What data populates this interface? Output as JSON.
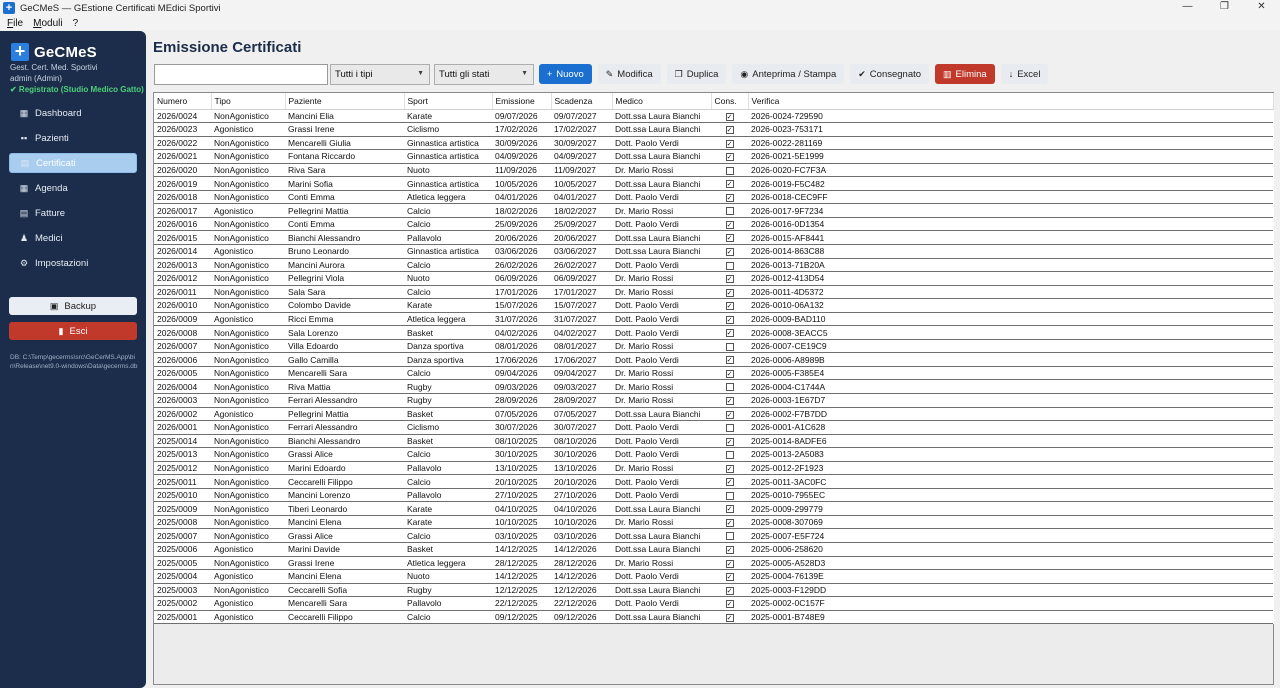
{
  "window": {
    "title": "GeCMeS — GEstione Certificati MEdici Sportivi",
    "minimize": "—",
    "maximize": "❐",
    "close": "✕"
  },
  "menu": [
    "File",
    "Moduli",
    "?"
  ],
  "sidebar": {
    "brand": "GeCMeS",
    "subtitle": "Gest. Cert. Med. Sportivi",
    "user": "admin (Admin)",
    "registered": "✔ Registrato (Studio Medico Gatto)",
    "items": [
      {
        "label": "Dashboard",
        "icon": "dashboard-icon",
        "glyph": "▦"
      },
      {
        "label": "Pazienti",
        "icon": "users-icon",
        "glyph": "👥"
      },
      {
        "label": "Certificati",
        "icon": "certificate-icon",
        "glyph": "▤"
      },
      {
        "label": "Agenda",
        "icon": "calendar-icon",
        "glyph": "▦"
      },
      {
        "label": "Fatture",
        "icon": "invoice-icon",
        "glyph": "▤"
      },
      {
        "label": "Medici",
        "icon": "doctor-icon",
        "glyph": "♟"
      },
      {
        "label": "Impostazioni",
        "icon": "gear-icon",
        "glyph": "⚙"
      }
    ],
    "backup_label": "Backup",
    "exit_label": "Esci",
    "db_path": "DB: C:\\Temp\\gecerms\\src\\GeCerMS.App\\bin\\Release\\net9.0-windows\\Data\\gecerms.db"
  },
  "main": {
    "heading": "Emissione Certificati",
    "search_value": "",
    "type_filter": "Tutti i tipi",
    "state_filter": "Tutti gli stati",
    "buttons": {
      "new": "Nuovo",
      "edit": "Modifica",
      "duplicate": "Duplica",
      "preview": "Anteprima / Stampa",
      "delivered": "Consegnato",
      "delete": "Elimina",
      "excel": "Excel"
    }
  },
  "table": {
    "columns": [
      "Numero",
      "Tipo",
      "Paziente",
      "Sport",
      "Emissione",
      "Scadenza",
      "Medico",
      "Cons.",
      "Verifica"
    ],
    "rows": [
      [
        "2026/0024",
        "NonAgonistico",
        "Mancini Elia",
        "Karate",
        "09/07/2026",
        "09/07/2027",
        "Dott.ssa Laura Bianchi",
        true,
        "2026-0024-729590"
      ],
      [
        "2026/0023",
        "Agonistico",
        "Grassi Irene",
        "Ciclismo",
        "17/02/2026",
        "17/02/2027",
        "Dott.ssa Laura Bianchi",
        true,
        "2026-0023-753171"
      ],
      [
        "2026/0022",
        "NonAgonistico",
        "Mencarelli Giulia",
        "Ginnastica artistica",
        "30/09/2026",
        "30/09/2027",
        "Dott. Paolo Verdi",
        true,
        "2026-0022-281169"
      ],
      [
        "2026/0021",
        "NonAgonistico",
        "Fontana Riccardo",
        "Ginnastica artistica",
        "04/09/2026",
        "04/09/2027",
        "Dott.ssa Laura Bianchi",
        true,
        "2026-0021-5E1999"
      ],
      [
        "2026/0020",
        "NonAgonistico",
        "Riva Sara",
        "Nuoto",
        "11/09/2026",
        "11/09/2027",
        "Dr. Mario Rossi",
        false,
        "2026-0020-FC7F3A"
      ],
      [
        "2026/0019",
        "NonAgonistico",
        "Marini Sofia",
        "Ginnastica artistica",
        "10/05/2026",
        "10/05/2027",
        "Dott.ssa Laura Bianchi",
        true,
        "2026-0019-F5C482"
      ],
      [
        "2026/0018",
        "NonAgonistico",
        "Conti Emma",
        "Atletica leggera",
        "04/01/2026",
        "04/01/2027",
        "Dott. Paolo Verdi",
        true,
        "2026-0018-CEC9FF"
      ],
      [
        "2026/0017",
        "Agonistico",
        "Pellegrini Mattia",
        "Calcio",
        "18/02/2026",
        "18/02/2027",
        "Dr. Mario Rossi",
        false,
        "2026-0017-9F7234"
      ],
      [
        "2026/0016",
        "NonAgonistico",
        "Conti Emma",
        "Calcio",
        "25/09/2026",
        "25/09/2027",
        "Dott. Paolo Verdi",
        true,
        "2026-0016-0D1354"
      ],
      [
        "2026/0015",
        "NonAgonistico",
        "Bianchi Alessandro",
        "Pallavolo",
        "20/06/2026",
        "20/06/2027",
        "Dott.ssa Laura Bianchi",
        true,
        "2026-0015-AF8441"
      ],
      [
        "2026/0014",
        "Agonistico",
        "Bruno Leonardo",
        "Ginnastica artistica",
        "03/06/2026",
        "03/06/2027",
        "Dott.ssa Laura Bianchi",
        true,
        "2026-0014-863C88"
      ],
      [
        "2026/0013",
        "NonAgonistico",
        "Mancini Aurora",
        "Calcio",
        "26/02/2026",
        "26/02/2027",
        "Dott. Paolo Verdi",
        false,
        "2026-0013-71B20A"
      ],
      [
        "2026/0012",
        "NonAgonistico",
        "Pellegrini Viola",
        "Nuoto",
        "06/09/2026",
        "06/09/2027",
        "Dr. Mario Rossi",
        true,
        "2026-0012-413D54"
      ],
      [
        "2026/0011",
        "NonAgonistico",
        "Sala Sara",
        "Calcio",
        "17/01/2026",
        "17/01/2027",
        "Dr. Mario Rossi",
        true,
        "2026-0011-4D5372"
      ],
      [
        "2026/0010",
        "NonAgonistico",
        "Colombo Davide",
        "Karate",
        "15/07/2026",
        "15/07/2027",
        "Dott. Paolo Verdi",
        true,
        "2026-0010-06A132"
      ],
      [
        "2026/0009",
        "Agonistico",
        "Ricci Emma",
        "Atletica leggera",
        "31/07/2026",
        "31/07/2027",
        "Dott. Paolo Verdi",
        true,
        "2026-0009-BAD110"
      ],
      [
        "2026/0008",
        "NonAgonistico",
        "Sala Lorenzo",
        "Basket",
        "04/02/2026",
        "04/02/2027",
        "Dott. Paolo Verdi",
        true,
        "2026-0008-3EACC5"
      ],
      [
        "2026/0007",
        "NonAgonistico",
        "Villa Edoardo",
        "Danza sportiva",
        "08/01/2026",
        "08/01/2027",
        "Dr. Mario Rossi",
        false,
        "2026-0007-CE19C9"
      ],
      [
        "2026/0006",
        "NonAgonistico",
        "Gallo Camilla",
        "Danza sportiva",
        "17/06/2026",
        "17/06/2027",
        "Dott. Paolo Verdi",
        true,
        "2026-0006-A8989B"
      ],
      [
        "2026/0005",
        "NonAgonistico",
        "Mencarelli Sara",
        "Calcio",
        "09/04/2026",
        "09/04/2027",
        "Dr. Mario Rossi",
        true,
        "2026-0005-F385E4"
      ],
      [
        "2026/0004",
        "NonAgonistico",
        "Riva Mattia",
        "Rugby",
        "09/03/2026",
        "09/03/2027",
        "Dr. Mario Rossi",
        false,
        "2026-0004-C1744A"
      ],
      [
        "2026/0003",
        "NonAgonistico",
        "Ferrari Alessandro",
        "Rugby",
        "28/09/2026",
        "28/09/2027",
        "Dr. Mario Rossi",
        true,
        "2026-0003-1E67D7"
      ],
      [
        "2026/0002",
        "Agonistico",
        "Pellegrini Mattia",
        "Basket",
        "07/05/2026",
        "07/05/2027",
        "Dott.ssa Laura Bianchi",
        true,
        "2026-0002-F7B7DD"
      ],
      [
        "2026/0001",
        "NonAgonistico",
        "Ferrari Alessandro",
        "Ciclismo",
        "30/07/2026",
        "30/07/2027",
        "Dott. Paolo Verdi",
        false,
        "2026-0001-A1C628"
      ],
      [
        "2025/0014",
        "NonAgonistico",
        "Bianchi Alessandro",
        "Basket",
        "08/10/2025",
        "08/10/2026",
        "Dott. Paolo Verdi",
        true,
        "2025-0014-8ADFE6"
      ],
      [
        "2025/0013",
        "NonAgonistico",
        "Grassi Alice",
        "Calcio",
        "30/10/2025",
        "30/10/2026",
        "Dott. Paolo Verdi",
        false,
        "2025-0013-2A5083"
      ],
      [
        "2025/0012",
        "NonAgonistico",
        "Marini Edoardo",
        "Pallavolo",
        "13/10/2025",
        "13/10/2026",
        "Dr. Mario Rossi",
        true,
        "2025-0012-2F1923"
      ],
      [
        "2025/0011",
        "NonAgonistico",
        "Ceccarelli Filippo",
        "Calcio",
        "20/10/2025",
        "20/10/2026",
        "Dott. Paolo Verdi",
        true,
        "2025-0011-3AC0FC"
      ],
      [
        "2025/0010",
        "NonAgonistico",
        "Mancini Lorenzo",
        "Pallavolo",
        "27/10/2025",
        "27/10/2026",
        "Dott. Paolo Verdi",
        false,
        "2025-0010-7955EC"
      ],
      [
        "2025/0009",
        "NonAgonistico",
        "Tiberi Leonardo",
        "Karate",
        "04/10/2025",
        "04/10/2026",
        "Dott.ssa Laura Bianchi",
        true,
        "2025-0009-299779"
      ],
      [
        "2025/0008",
        "NonAgonistico",
        "Mancini Elena",
        "Karate",
        "10/10/2025",
        "10/10/2026",
        "Dr. Mario Rossi",
        true,
        "2025-0008-307069"
      ],
      [
        "2025/0007",
        "NonAgonistico",
        "Grassi Alice",
        "Calcio",
        "03/10/2025",
        "03/10/2026",
        "Dott.ssa Laura Bianchi",
        false,
        "2025-0007-E5F724"
      ],
      [
        "2025/0006",
        "Agonistico",
        "Marini Davide",
        "Basket",
        "14/12/2025",
        "14/12/2026",
        "Dott.ssa Laura Bianchi",
        true,
        "2025-0006-258620"
      ],
      [
        "2025/0005",
        "NonAgonistico",
        "Grassi Irene",
        "Atletica leggera",
        "28/12/2025",
        "28/12/2026",
        "Dr. Mario Rossi",
        true,
        "2025-0005-A528D3"
      ],
      [
        "2025/0004",
        "Agonistico",
        "Mancini Elena",
        "Nuoto",
        "14/12/2025",
        "14/12/2026",
        "Dott. Paolo Verdi",
        true,
        "2025-0004-76139E"
      ],
      [
        "2025/0003",
        "NonAgonistico",
        "Ceccarelli Sofia",
        "Rugby",
        "12/12/2025",
        "12/12/2026",
        "Dott.ssa Laura Bianchi",
        true,
        "2025-0003-F129DD"
      ],
      [
        "2025/0002",
        "Agonistico",
        "Mencarelli Sara",
        "Pallavolo",
        "22/12/2025",
        "22/12/2026",
        "Dott. Paolo Verdi",
        true,
        "2025-0002-0C157F"
      ],
      [
        "2025/0001",
        "Agonistico",
        "Ceccarelli Filippo",
        "Calcio",
        "09/12/2025",
        "09/12/2026",
        "Dott.ssa Laura Bianchi",
        true,
        "2025-0001-B748E9"
      ]
    ]
  }
}
